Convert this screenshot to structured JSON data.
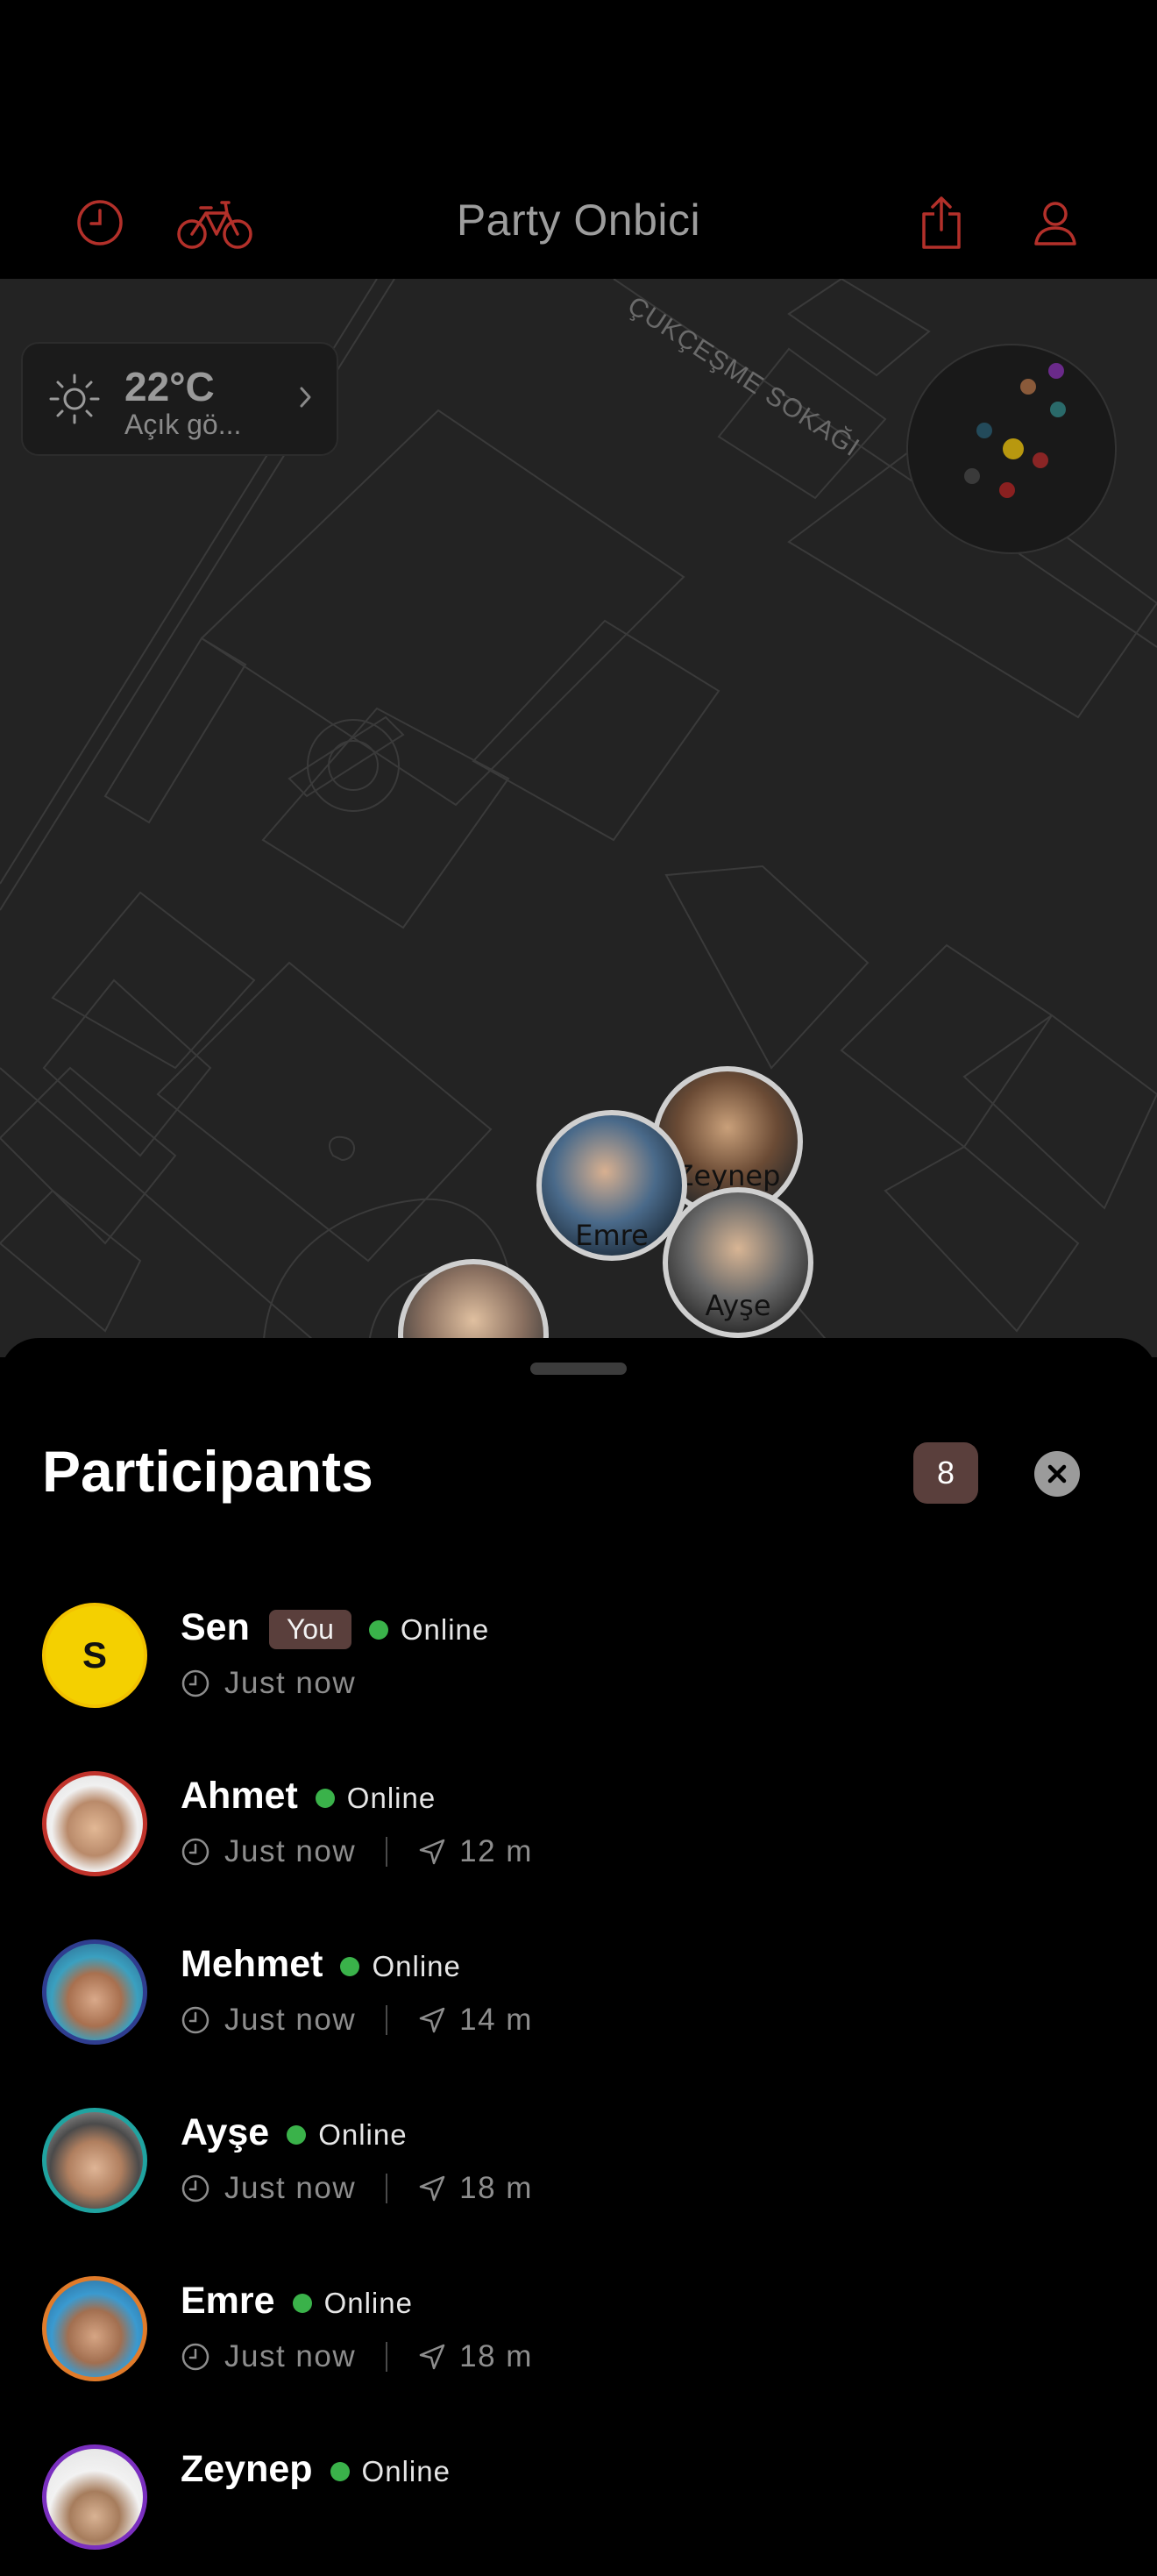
{
  "header": {
    "title": "Party Onbici",
    "left_icons": [
      "history-icon",
      "bicycle-icon"
    ],
    "right_icons": [
      "share-icon",
      "profile-icon"
    ],
    "accent_color": "#b3302a"
  },
  "map": {
    "street_name": "ÇUKÇEŞME SOKAĞI",
    "weather": {
      "temperature": "22°C",
      "description": "Açık gö..."
    },
    "pins": [
      {
        "label": "Zeynep"
      },
      {
        "label": "Emre"
      },
      {
        "label": "Ayşe"
      },
      {
        "label": ""
      }
    ]
  },
  "sheet": {
    "title": "Participants",
    "count": "8",
    "participants": [
      {
        "name": "Sen",
        "badge": "You",
        "status": "Online",
        "time": "Just now",
        "distance": "",
        "initial": "S",
        "ring_color": "#f2c200"
      },
      {
        "name": "Ahmet",
        "status": "Online",
        "time": "Just now",
        "distance": "12 m",
        "ring_color": "#c0332b"
      },
      {
        "name": "Mehmet",
        "status": "Online",
        "time": "Just now",
        "distance": "14 m",
        "ring_color": "#2f3d8f"
      },
      {
        "name": "Ayşe",
        "status": "Online",
        "time": "Just now",
        "distance": "18 m",
        "ring_color": "#20a3a0"
      },
      {
        "name": "Emre",
        "status": "Online",
        "time": "Just now",
        "distance": "18 m",
        "ring_color": "#e07b2a"
      },
      {
        "name": "Zeynep",
        "status": "Online",
        "time": "",
        "distance": "",
        "ring_color": "#7a2fbf"
      }
    ]
  }
}
